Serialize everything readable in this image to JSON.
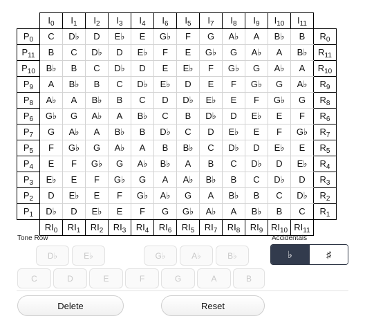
{
  "matrix": {
    "top_labels": [
      {
        "l": "I",
        "s": "0"
      },
      {
        "l": "I",
        "s": "1"
      },
      {
        "l": "I",
        "s": "2"
      },
      {
        "l": "I",
        "s": "3"
      },
      {
        "l": "I",
        "s": "4"
      },
      {
        "l": "I",
        "s": "6"
      },
      {
        "l": "I",
        "s": "5"
      },
      {
        "l": "I",
        "s": "7"
      },
      {
        "l": "I",
        "s": "8"
      },
      {
        "l": "I",
        "s": "9"
      },
      {
        "l": "I",
        "s": "10"
      },
      {
        "l": "I",
        "s": "11"
      }
    ],
    "bottom_labels": [
      {
        "l": "RI",
        "s": "0"
      },
      {
        "l": "RI",
        "s": "1"
      },
      {
        "l": "RI",
        "s": "2"
      },
      {
        "l": "RI",
        "s": "3"
      },
      {
        "l": "RI",
        "s": "4"
      },
      {
        "l": "RI",
        "s": "6"
      },
      {
        "l": "RI",
        "s": "5"
      },
      {
        "l": "RI",
        "s": "7"
      },
      {
        "l": "RI",
        "s": "8"
      },
      {
        "l": "RI",
        "s": "9"
      },
      {
        "l": "RI",
        "s": "10"
      },
      {
        "l": "RI",
        "s": "11"
      }
    ],
    "rows": [
      {
        "p": "0",
        "r": "0",
        "notes": [
          "C",
          "D♭",
          "D",
          "E♭",
          "E",
          "G♭",
          "F",
          "G",
          "A♭",
          "A",
          "B♭",
          "B"
        ]
      },
      {
        "p": "11",
        "r": "11",
        "notes": [
          "B",
          "C",
          "D♭",
          "D",
          "E♭",
          "F",
          "E",
          "G♭",
          "G",
          "A♭",
          "A",
          "B♭"
        ]
      },
      {
        "p": "10",
        "r": "10",
        "notes": [
          "B♭",
          "B",
          "C",
          "D♭",
          "D",
          "E",
          "E♭",
          "F",
          "G♭",
          "G",
          "A♭",
          "A"
        ]
      },
      {
        "p": "9",
        "r": "9",
        "notes": [
          "A",
          "B♭",
          "B",
          "C",
          "D♭",
          "E♭",
          "D",
          "E",
          "F",
          "G♭",
          "G",
          "A♭"
        ]
      },
      {
        "p": "8",
        "r": "8",
        "notes": [
          "A♭",
          "A",
          "B♭",
          "B",
          "C",
          "D",
          "D♭",
          "E♭",
          "E",
          "F",
          "G♭",
          "G"
        ]
      },
      {
        "p": "6",
        "r": "6",
        "notes": [
          "G♭",
          "G",
          "A♭",
          "A",
          "B♭",
          "C",
          "B",
          "D♭",
          "D",
          "E♭",
          "E",
          "F"
        ]
      },
      {
        "p": "7",
        "r": "7",
        "notes": [
          "G",
          "A♭",
          "A",
          "B♭",
          "B",
          "D♭",
          "C",
          "D",
          "E♭",
          "E",
          "F",
          "G♭"
        ]
      },
      {
        "p": "5",
        "r": "5",
        "notes": [
          "F",
          "G♭",
          "G",
          "A♭",
          "A",
          "B",
          "B♭",
          "C",
          "D♭",
          "D",
          "E♭",
          "E"
        ]
      },
      {
        "p": "4",
        "r": "4",
        "notes": [
          "E",
          "F",
          "G♭",
          "G",
          "A♭",
          "B♭",
          "A",
          "B",
          "C",
          "D♭",
          "D",
          "E♭"
        ]
      },
      {
        "p": "3",
        "r": "3",
        "notes": [
          "E♭",
          "E",
          "F",
          "G♭",
          "G",
          "A",
          "A♭",
          "B♭",
          "B",
          "C",
          "D♭",
          "D"
        ]
      },
      {
        "p": "2",
        "r": "2",
        "notes": [
          "D",
          "E♭",
          "E",
          "F",
          "G♭",
          "A♭",
          "G",
          "A",
          "B♭",
          "B",
          "C",
          "D♭"
        ]
      },
      {
        "p": "1",
        "r": "1",
        "notes": [
          "D♭",
          "D",
          "E♭",
          "E",
          "F",
          "G",
          "G♭",
          "A♭",
          "A",
          "B♭",
          "B",
          "C"
        ]
      }
    ]
  },
  "tone_row": {
    "label": "Tone Row",
    "black_keys": [
      "D♭",
      "E♭",
      "G♭",
      "A♭",
      "B♭"
    ],
    "white_keys": [
      "C",
      "D",
      "E",
      "F",
      "G",
      "A",
      "B"
    ]
  },
  "accidentals": {
    "label": "Accidentals",
    "flat_symbol": "♭",
    "sharp_symbol": "♯",
    "selected": "flat"
  },
  "actions": {
    "delete_label": "Delete",
    "reset_label": "Reset"
  }
}
